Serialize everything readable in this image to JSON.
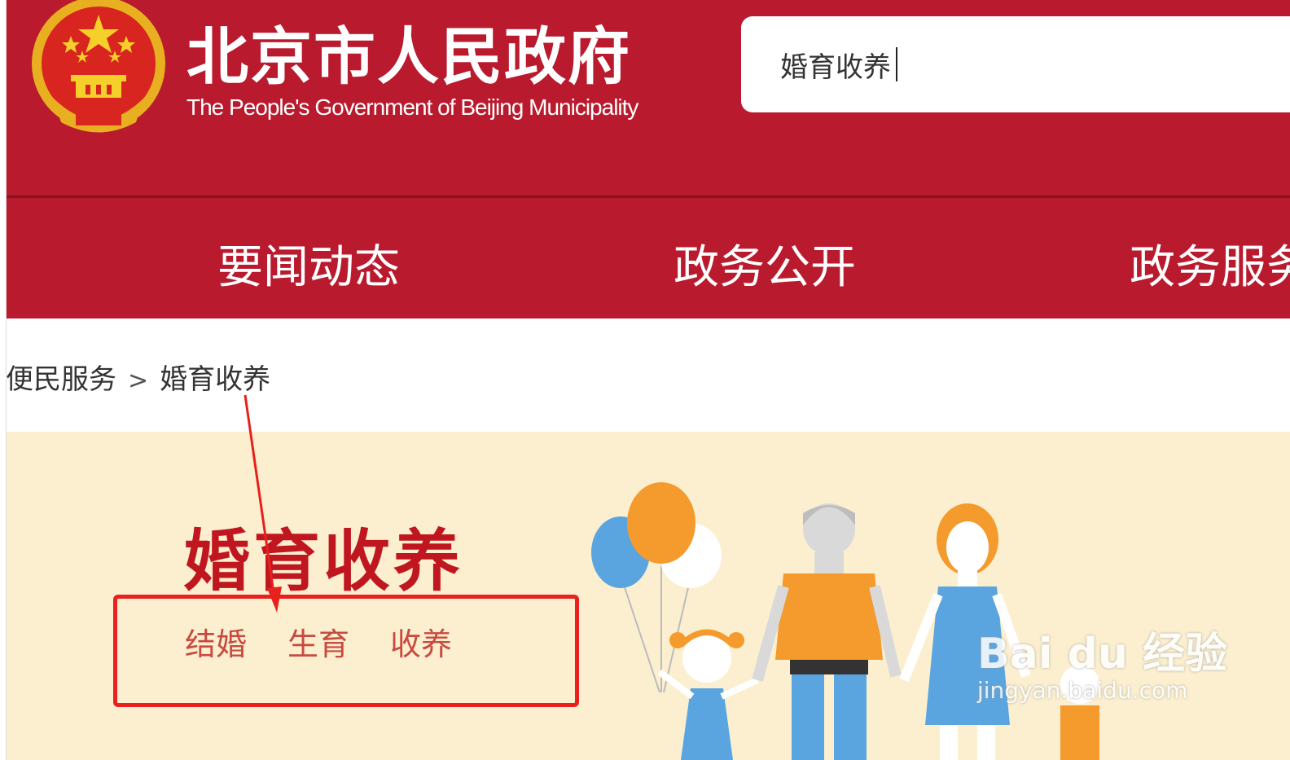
{
  "header": {
    "site_title": "北京市人民政府",
    "site_subtitle": "The People's Government of Beijing Municipality",
    "emblem_icon": "national-emblem-icon"
  },
  "search": {
    "value": "婚育收养"
  },
  "nav": {
    "items": [
      {
        "label": "要闻动态"
      },
      {
        "label": "政务公开"
      },
      {
        "label": "政务服务"
      }
    ]
  },
  "breadcrumb": {
    "parent": "便民服务",
    "separator": ">",
    "current": "婚育收养"
  },
  "banner": {
    "title": "婚育收养",
    "links": [
      {
        "label": "结婚"
      },
      {
        "label": "生育"
      },
      {
        "label": "收养"
      }
    ]
  },
  "watermark": {
    "logo": "Bai du 经验",
    "url": "jingyan.baidu.com"
  },
  "colors": {
    "brand_red": "#b91a2e",
    "banner_bg": "#fbefcf",
    "annotation_red": "#e8201e"
  }
}
